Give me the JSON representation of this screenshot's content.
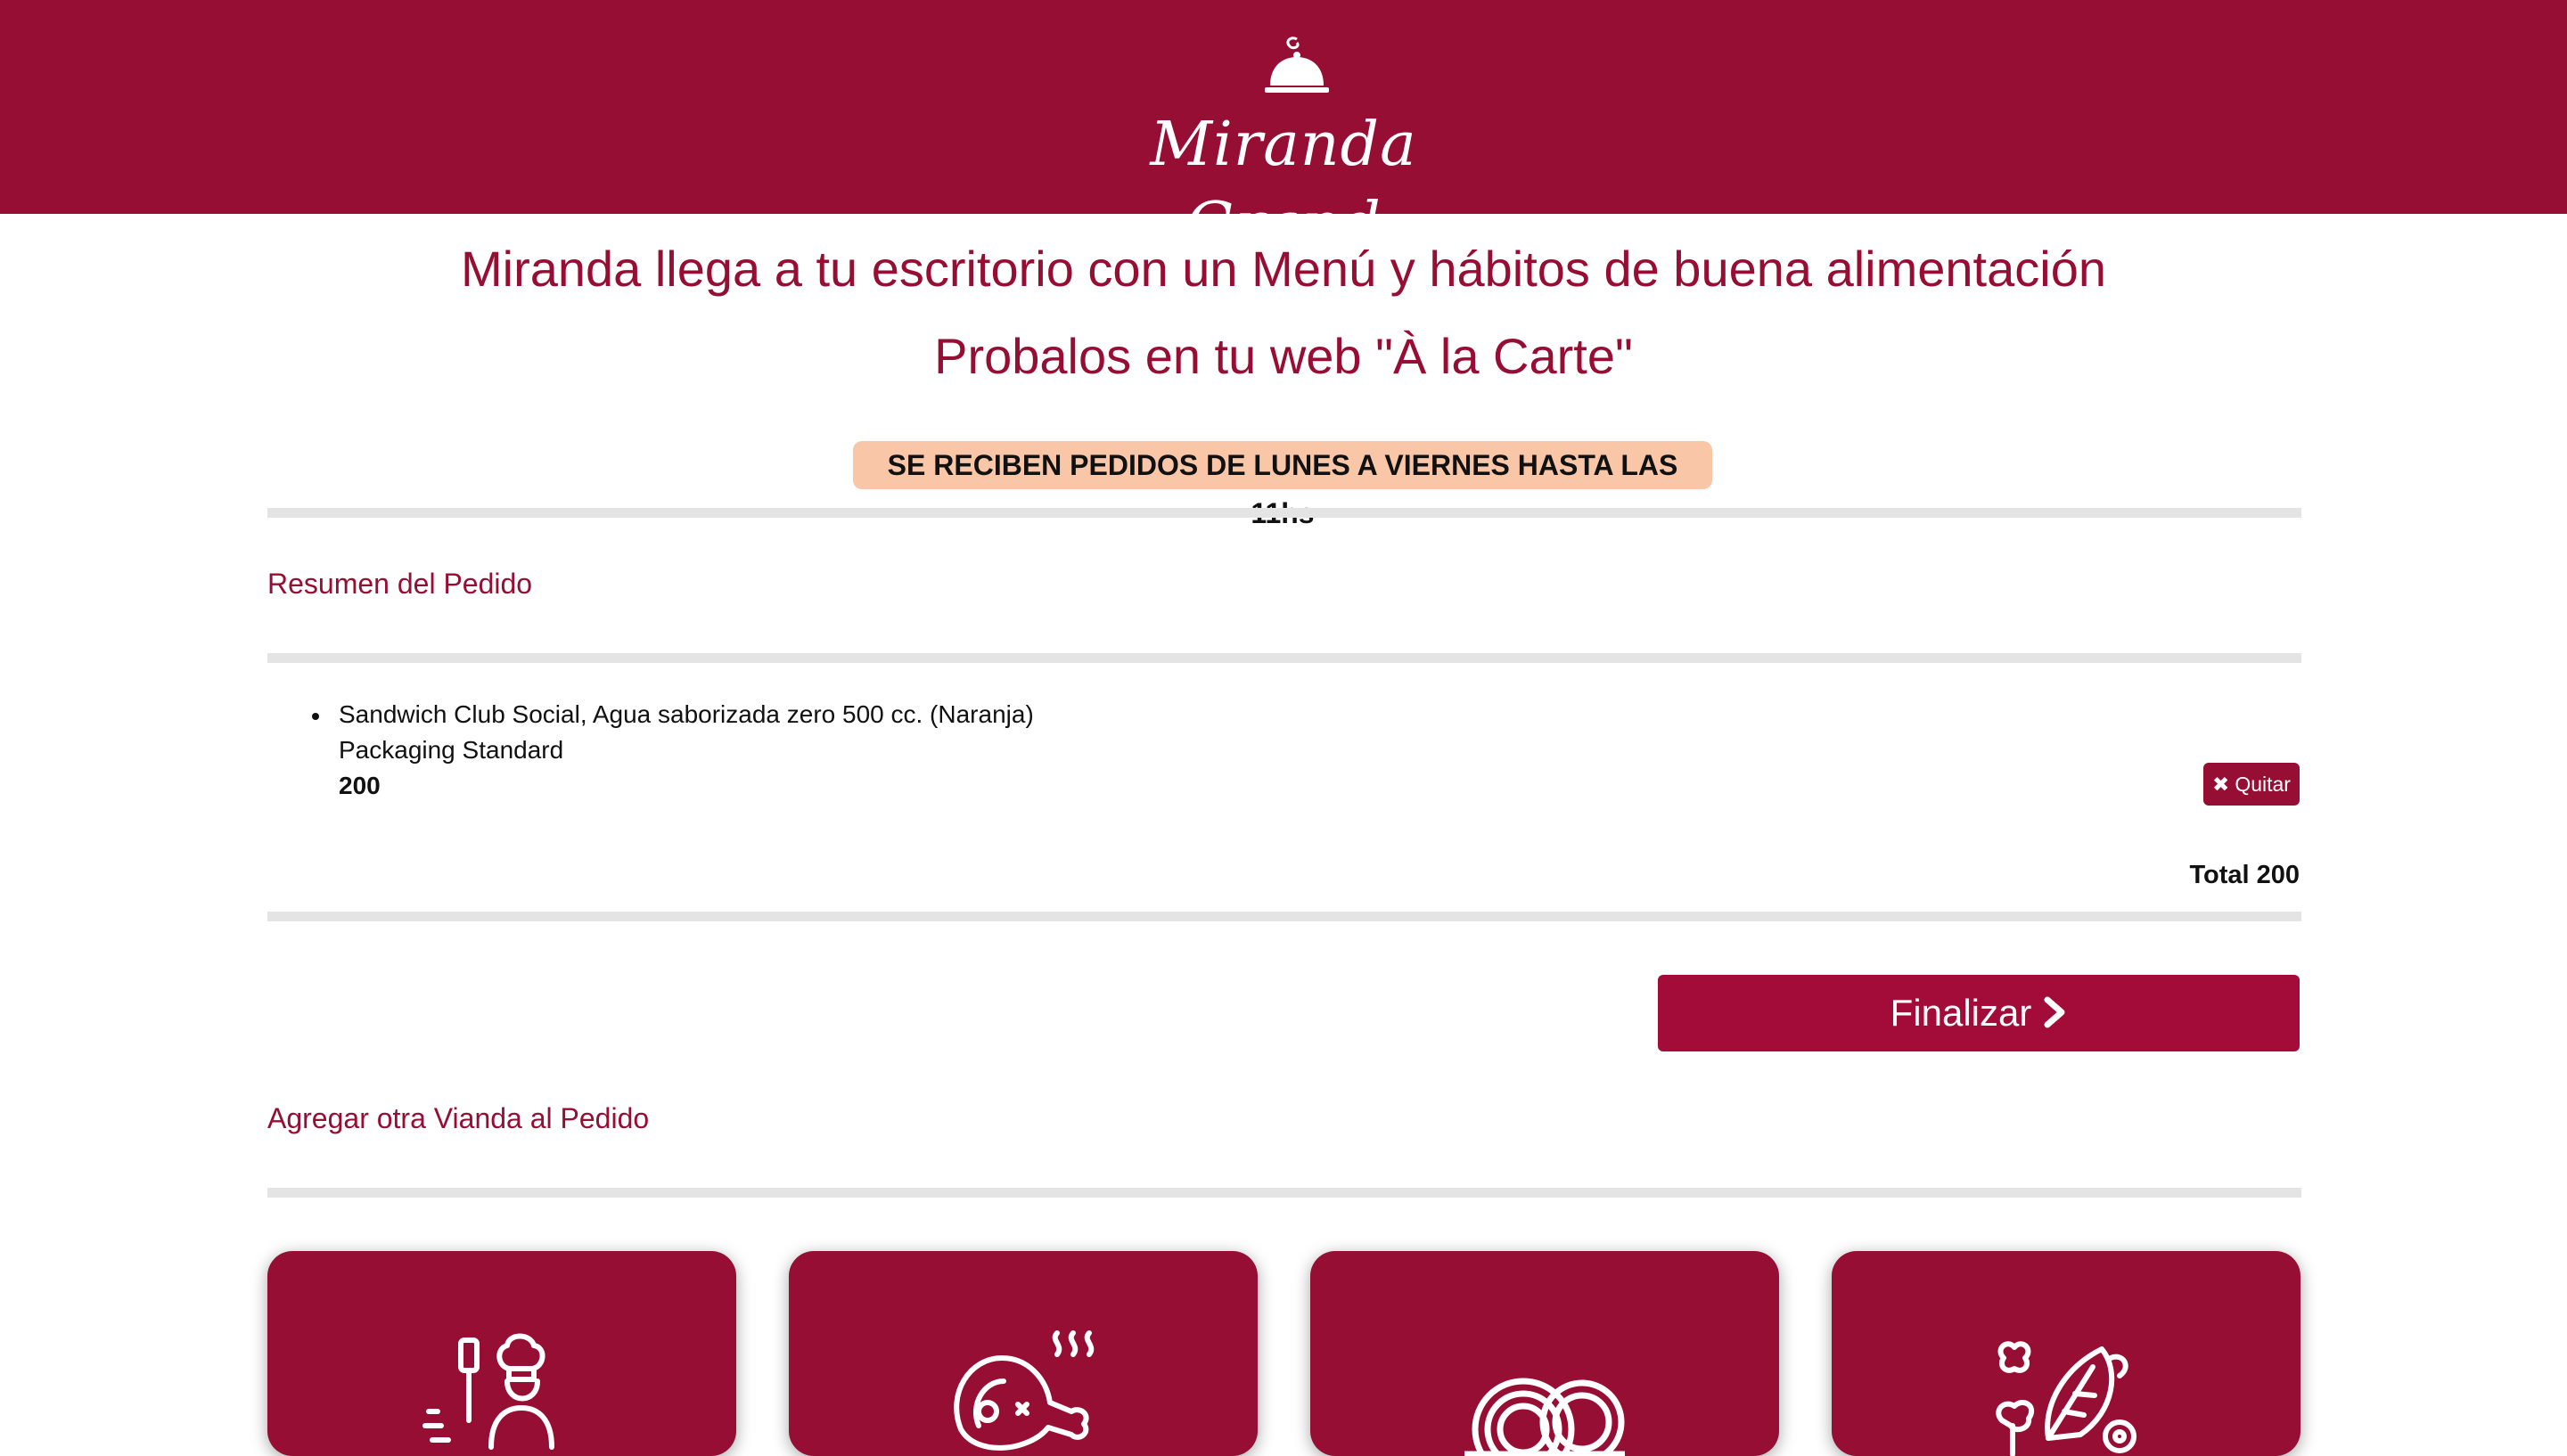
{
  "header": {
    "brand": "Miranda Grand",
    "logo_icon": "cloche-icon",
    "background": "#960e33"
  },
  "tagline": {
    "line1": "Miranda llega a tu escritorio con un Menú y hábitos de buena alimentación",
    "line2": "Probalos en tu web \"À la Carte\""
  },
  "notice": {
    "text": "SE RECIBEN PEDIDOS DE LUNES A VIERNES HASTA LAS 11hs",
    "background": "#f9c6a8"
  },
  "order_summary": {
    "title": "Resumen del Pedido",
    "items": [
      {
        "description": "Sandwich Club Social, Agua saborizada zero 500 cc. (Naranja)",
        "packaging": "Packaging Standard",
        "price": "200",
        "remove_label": "Quitar",
        "remove_icon": "close-icon"
      }
    ],
    "total": "Total 200"
  },
  "finalize": {
    "label": "Finalizar",
    "icon": "chevron-right-icon"
  },
  "add_section": {
    "title": "Agregar otra Vianda al Pedido"
  },
  "categories": [
    {
      "icon": "chef-icon"
    },
    {
      "icon": "meat-icon"
    },
    {
      "icon": "pasta-icon"
    },
    {
      "icon": "vegetables-icon"
    }
  ],
  "colors": {
    "brand": "#960e33",
    "button": "#a30c38",
    "divider": "#e4e4e4"
  }
}
